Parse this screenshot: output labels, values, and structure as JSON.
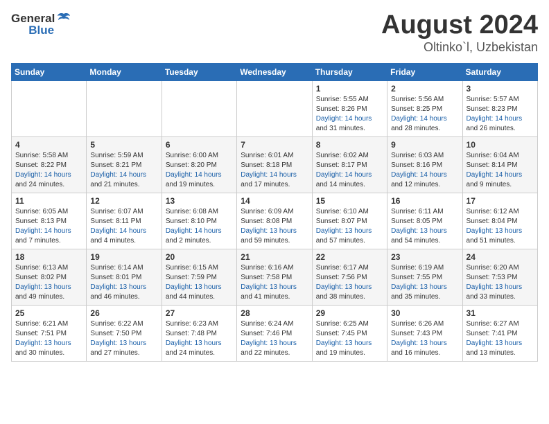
{
  "header": {
    "logo_general": "General",
    "logo_blue": "Blue",
    "title": "August 2024",
    "subtitle": "Oltinko`l, Uzbekistan"
  },
  "weekdays": [
    "Sunday",
    "Monday",
    "Tuesday",
    "Wednesday",
    "Thursday",
    "Friday",
    "Saturday"
  ],
  "weeks": [
    [
      {
        "day": "",
        "info": ""
      },
      {
        "day": "",
        "info": ""
      },
      {
        "day": "",
        "info": ""
      },
      {
        "day": "",
        "info": ""
      },
      {
        "day": "1",
        "info": "Sunrise: 5:55 AM\nSunset: 8:26 PM\nDaylight: 14 hours\nand 31 minutes."
      },
      {
        "day": "2",
        "info": "Sunrise: 5:56 AM\nSunset: 8:25 PM\nDaylight: 14 hours\nand 28 minutes."
      },
      {
        "day": "3",
        "info": "Sunrise: 5:57 AM\nSunset: 8:23 PM\nDaylight: 14 hours\nand 26 minutes."
      }
    ],
    [
      {
        "day": "4",
        "info": "Sunrise: 5:58 AM\nSunset: 8:22 PM\nDaylight: 14 hours\nand 24 minutes."
      },
      {
        "day": "5",
        "info": "Sunrise: 5:59 AM\nSunset: 8:21 PM\nDaylight: 14 hours\nand 21 minutes."
      },
      {
        "day": "6",
        "info": "Sunrise: 6:00 AM\nSunset: 8:20 PM\nDaylight: 14 hours\nand 19 minutes."
      },
      {
        "day": "7",
        "info": "Sunrise: 6:01 AM\nSunset: 8:18 PM\nDaylight: 14 hours\nand 17 minutes."
      },
      {
        "day": "8",
        "info": "Sunrise: 6:02 AM\nSunset: 8:17 PM\nDaylight: 14 hours\nand 14 minutes."
      },
      {
        "day": "9",
        "info": "Sunrise: 6:03 AM\nSunset: 8:16 PM\nDaylight: 14 hours\nand 12 minutes."
      },
      {
        "day": "10",
        "info": "Sunrise: 6:04 AM\nSunset: 8:14 PM\nDaylight: 14 hours\nand 9 minutes."
      }
    ],
    [
      {
        "day": "11",
        "info": "Sunrise: 6:05 AM\nSunset: 8:13 PM\nDaylight: 14 hours\nand 7 minutes."
      },
      {
        "day": "12",
        "info": "Sunrise: 6:07 AM\nSunset: 8:11 PM\nDaylight: 14 hours\nand 4 minutes."
      },
      {
        "day": "13",
        "info": "Sunrise: 6:08 AM\nSunset: 8:10 PM\nDaylight: 14 hours\nand 2 minutes."
      },
      {
        "day": "14",
        "info": "Sunrise: 6:09 AM\nSunset: 8:08 PM\nDaylight: 13 hours\nand 59 minutes."
      },
      {
        "day": "15",
        "info": "Sunrise: 6:10 AM\nSunset: 8:07 PM\nDaylight: 13 hours\nand 57 minutes."
      },
      {
        "day": "16",
        "info": "Sunrise: 6:11 AM\nSunset: 8:05 PM\nDaylight: 13 hours\nand 54 minutes."
      },
      {
        "day": "17",
        "info": "Sunrise: 6:12 AM\nSunset: 8:04 PM\nDaylight: 13 hours\nand 51 minutes."
      }
    ],
    [
      {
        "day": "18",
        "info": "Sunrise: 6:13 AM\nSunset: 8:02 PM\nDaylight: 13 hours\nand 49 minutes."
      },
      {
        "day": "19",
        "info": "Sunrise: 6:14 AM\nSunset: 8:01 PM\nDaylight: 13 hours\nand 46 minutes."
      },
      {
        "day": "20",
        "info": "Sunrise: 6:15 AM\nSunset: 7:59 PM\nDaylight: 13 hours\nand 44 minutes."
      },
      {
        "day": "21",
        "info": "Sunrise: 6:16 AM\nSunset: 7:58 PM\nDaylight: 13 hours\nand 41 minutes."
      },
      {
        "day": "22",
        "info": "Sunrise: 6:17 AM\nSunset: 7:56 PM\nDaylight: 13 hours\nand 38 minutes."
      },
      {
        "day": "23",
        "info": "Sunrise: 6:19 AM\nSunset: 7:55 PM\nDaylight: 13 hours\nand 35 minutes."
      },
      {
        "day": "24",
        "info": "Sunrise: 6:20 AM\nSunset: 7:53 PM\nDaylight: 13 hours\nand 33 minutes."
      }
    ],
    [
      {
        "day": "25",
        "info": "Sunrise: 6:21 AM\nSunset: 7:51 PM\nDaylight: 13 hours\nand 30 minutes."
      },
      {
        "day": "26",
        "info": "Sunrise: 6:22 AM\nSunset: 7:50 PM\nDaylight: 13 hours\nand 27 minutes."
      },
      {
        "day": "27",
        "info": "Sunrise: 6:23 AM\nSunset: 7:48 PM\nDaylight: 13 hours\nand 24 minutes."
      },
      {
        "day": "28",
        "info": "Sunrise: 6:24 AM\nSunset: 7:46 PM\nDaylight: 13 hours\nand 22 minutes."
      },
      {
        "day": "29",
        "info": "Sunrise: 6:25 AM\nSunset: 7:45 PM\nDaylight: 13 hours\nand 19 minutes."
      },
      {
        "day": "30",
        "info": "Sunrise: 6:26 AM\nSunset: 7:43 PM\nDaylight: 13 hours\nand 16 minutes."
      },
      {
        "day": "31",
        "info": "Sunrise: 6:27 AM\nSunset: 7:41 PM\nDaylight: 13 hours\nand 13 minutes."
      }
    ]
  ]
}
